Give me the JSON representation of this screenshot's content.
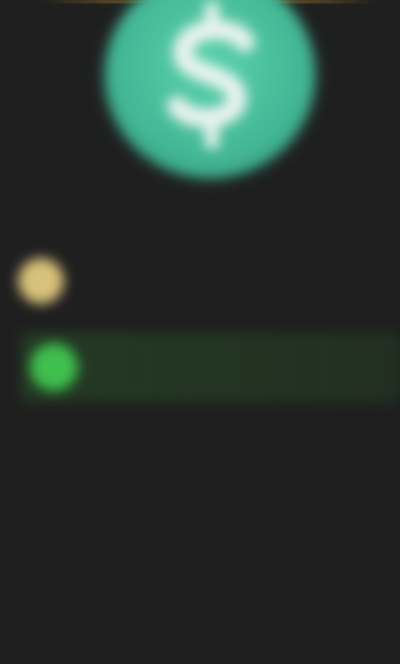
{
  "app": {
    "title": ""
  },
  "logo": {
    "icon": "app-logo-icon",
    "color": "#4cc2a0"
  },
  "header": {
    "title": ""
  },
  "options": [
    {
      "icon": "status-dot-icon",
      "color": "#d8c27b",
      "label": ""
    },
    {
      "icon": "status-dot-icon",
      "color": "#3fbf4e",
      "label": ""
    }
  ]
}
